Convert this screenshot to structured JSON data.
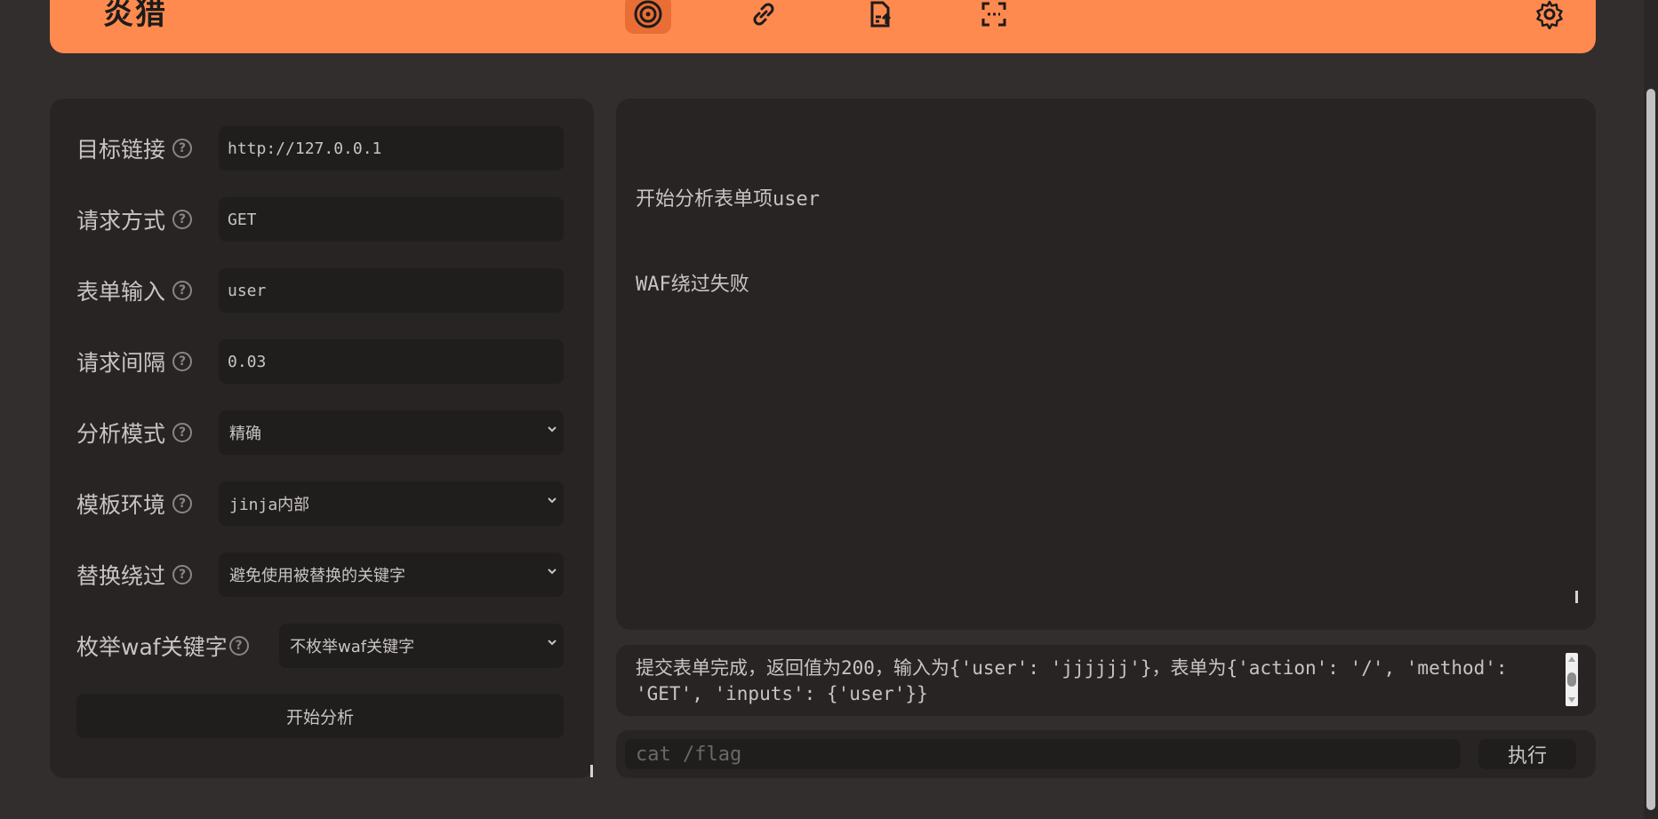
{
  "header": {
    "brand": "炎猎",
    "nav_icons": [
      "target-icon",
      "link-icon",
      "file-upload-icon",
      "scan-icon"
    ],
    "settings_icon": "gear-icon",
    "accent": "#ff8a4f"
  },
  "form": {
    "target_url": {
      "label": "目标链接",
      "value": "http://127.0.0.1"
    },
    "method": {
      "label": "请求方式",
      "value": "GET"
    },
    "form_input": {
      "label": "表单输入",
      "value": "user"
    },
    "interval": {
      "label": "请求间隔",
      "value": "0.03"
    },
    "mode": {
      "label": "分析模式",
      "value": "精确"
    },
    "template_env": {
      "label": "模板环境",
      "value": "jinja内部"
    },
    "replace_bypass": {
      "label": "替换绕过",
      "value": "避免使用被替换的关键字"
    },
    "waf_enum": {
      "label": "枚举waf关键字",
      "value": "不枚举waf关键字"
    },
    "help_glyph": "?",
    "start_label": "开始分析"
  },
  "output": {
    "lines": [
      "开始分析表单项user",
      "WAF绕过失败"
    ]
  },
  "result": {
    "text": "提交表单完成，返回值为200，输入为{'user': 'jjjjjj'}，表单为{'action': '/', 'method': 'GET', 'inputs': {'user'}}"
  },
  "command": {
    "placeholder": "cat /flag",
    "exec_label": "执行"
  }
}
